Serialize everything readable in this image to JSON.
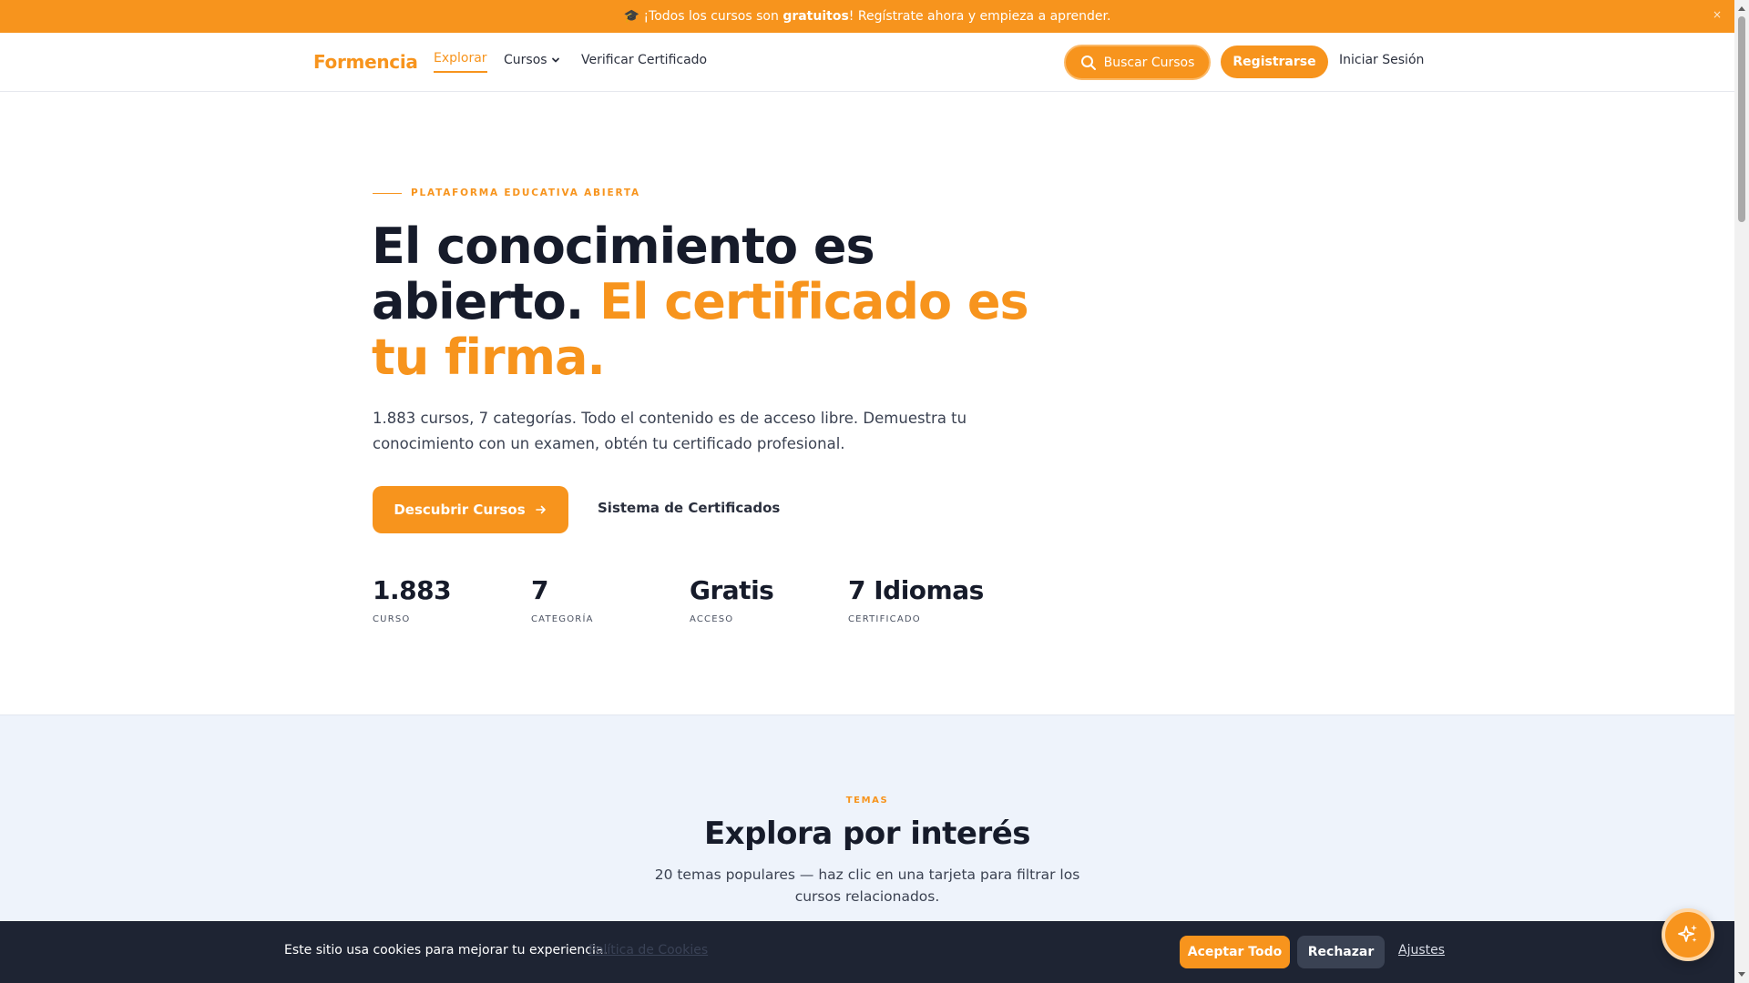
{
  "announcement": {
    "icon": "graduation-cap-icon",
    "text_before": "🎓 ¡Todos los cursos son ",
    "text_bold": "gratuitos",
    "text_after": "! Regístrate ahora y empieza a aprender.",
    "close_label": "×"
  },
  "header": {
    "logo": "Formencia",
    "nav": {
      "explore": "Explorar",
      "courses": "Cursos",
      "verify": "Verificar Certificado"
    },
    "search_button": "Buscar Cursos",
    "register_button": "Registrarse",
    "login_link": "Iniciar Sesión"
  },
  "hero": {
    "eyebrow": "PLATAFORMA EDUCATIVA ABIERTA",
    "title_line1": "El conocimiento es",
    "title_line2_start": "abierto. ",
    "title_accent_1": "El certificado es",
    "title_accent_2": "tu firma.",
    "subtitle": "1.883 cursos, 7 categorías. Todo el contenido es de acceso libre. Demuestra tu conocimiento con un examen, obtén tu certificado profesional.",
    "primary_button": "Descubrir Cursos",
    "secondary_link": "Sistema de Certificados",
    "stats": [
      {
        "value": "1.883",
        "label": "CURSO"
      },
      {
        "value": "7",
        "label": "CATEGORÍA"
      },
      {
        "value": "Gratis",
        "label": "ACCESO"
      },
      {
        "value": "7 Idiomas",
        "label": "CERTIFICADO"
      }
    ]
  },
  "topics": {
    "eyebrow": "TEMAS",
    "title": "Explora por interés",
    "subtitle": "20 temas populares — haz clic en una tarjeta para filtrar los cursos relacionados."
  },
  "cookie": {
    "text": "Este sitio usa cookies para mejorar tu experiencia.",
    "policy_link": "Política de Cookies",
    "accept_button": "Aceptar Todo",
    "reject_button": "Rechazar",
    "settings_link": "Ajustes"
  },
  "colors": {
    "accent": "#f7941d",
    "dark": "#161b2a",
    "cookie_bg": "#1e2433",
    "section_bg": "#eef3fb"
  }
}
